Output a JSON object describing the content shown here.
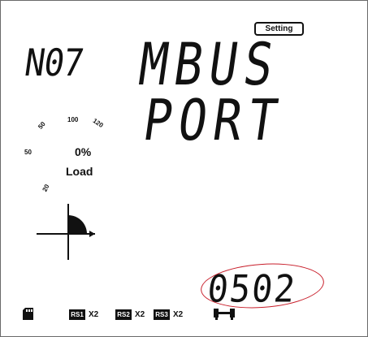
{
  "display": {
    "settings_badge": "Setting",
    "menu_number": "N07",
    "title_line1": "MBUS",
    "title_line2": "PORT",
    "current_value": "0502"
  },
  "load_gauge": {
    "ticks": [
      "20",
      "50",
      "80",
      "100",
      "120"
    ],
    "percent": "0%",
    "label": "Load"
  },
  "status_bar": {
    "channels": [
      {
        "label": "RS1",
        "count": "X2"
      },
      {
        "label": "RS2",
        "count": "X2"
      },
      {
        "label": "RS3",
        "count": "X2"
      }
    ]
  },
  "icons": [
    "quadrant-icon",
    "memory-card-icon",
    "port-icon"
  ],
  "colors": {
    "highlight": "#c81e2a",
    "ink": "#111111",
    "background": "#ffffff"
  }
}
